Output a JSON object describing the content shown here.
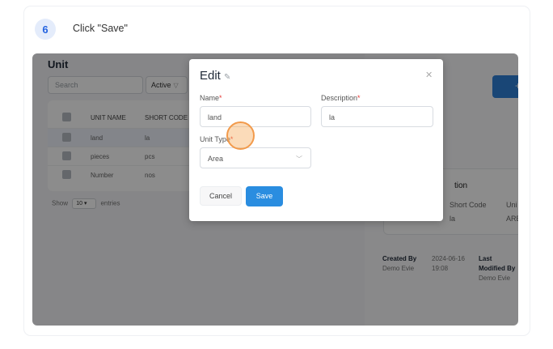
{
  "step": {
    "number": "6",
    "instruction": "Click \"Save\""
  },
  "app": {
    "title": "Unit",
    "search_placeholder": "Search",
    "filter_value": "Active",
    "add_button_label": "+",
    "table": {
      "headers": [
        "UNIT NAME",
        "SHORT CODE"
      ],
      "rows": [
        {
          "name": "land",
          "code": "la"
        },
        {
          "name": "pieces",
          "code": "pcs"
        },
        {
          "name": "Number",
          "code": "nos"
        }
      ]
    },
    "pagination": {
      "show_label": "Show",
      "page_size": "10",
      "entries_label": "entries"
    }
  },
  "detail": {
    "title": "tion",
    "short_code_label": "Short Code",
    "unit_label": "Uni",
    "short_code_value": "la",
    "unit_value": "ARE",
    "created_by_label": "Created By",
    "created_by_value": "Demo Evie",
    "created_date": "2024-06-16",
    "created_time": "19:08",
    "last_label": "Last",
    "modified_by_label": "Modified By",
    "modified_by_value": "Demo Evie"
  },
  "modal": {
    "title": "Edit",
    "name_label": "Name",
    "name_value": "land",
    "description_label": "Description",
    "description_value": "la",
    "unit_type_label": "Unit Type",
    "unit_type_value": "Area",
    "required_mark": "*",
    "cancel_label": "Cancel",
    "save_label": "Save"
  },
  "colors": {
    "accent": "#2a8de0",
    "highlight": "#f29a4b",
    "required": "#e53935"
  }
}
